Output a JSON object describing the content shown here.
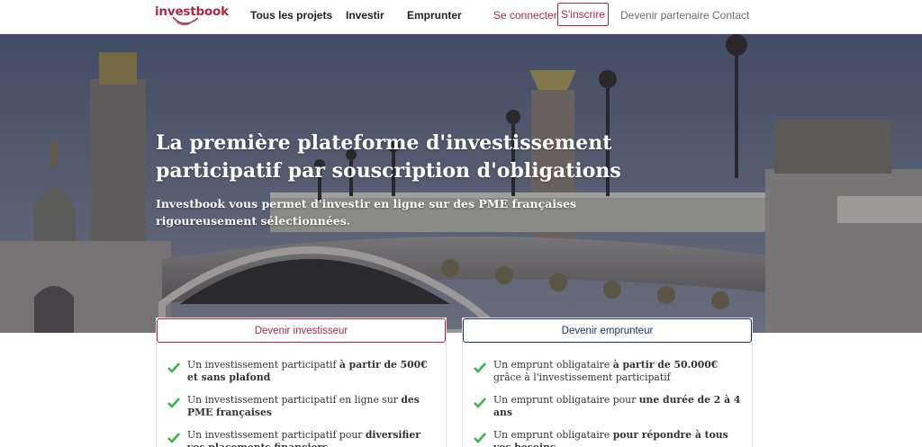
{
  "nav": {
    "logo_text": "investbook",
    "links": [
      "Tous les projets",
      "Investir",
      "Emprunter"
    ],
    "login": "Se connecter",
    "signup": "S'inscrire",
    "partner": "Devenir partenaire",
    "contact": "Contact"
  },
  "hero": {
    "title": "La première plateforme d'investissement participatif par souscription d'obligations",
    "subtitle": "Investbook vous permet d'investir en ligne sur des PME françaises rigoureusement sélectionnées."
  },
  "cards": [
    {
      "button": "Devenir investisseur",
      "items": [
        {
          "pre": "Un investissement participatif ",
          "bold": "à partir de 500€ et sans plafond",
          "post": ""
        },
        {
          "pre": "Un investissement participatif en ligne sur ",
          "bold": "des PME françaises",
          "post": ""
        },
        {
          "pre": "Un investissement participatif pour ",
          "bold": "diversifier vos placements financiers",
          "post": ""
        }
      ]
    },
    {
      "button": "Devenir emprunteur",
      "items": [
        {
          "pre": "Un emprunt obligataire ",
          "bold": "à partir de 50.000€",
          "post": " grâce à l'investissement participatif"
        },
        {
          "pre": "Un emprunt obligataire pour ",
          "bold": "une durée de 2 à 4 ans",
          "post": ""
        },
        {
          "pre": "Un emprunt obligataire ",
          "bold": "pour répondre à tous vos besoins",
          "post": ""
        }
      ]
    }
  ],
  "colors": {
    "brand": "#b02744",
    "navy": "#1f2d6e",
    "check": "#3bb54a"
  },
  "icons": {
    "check": "check-icon",
    "logo": "investbook-logo"
  }
}
